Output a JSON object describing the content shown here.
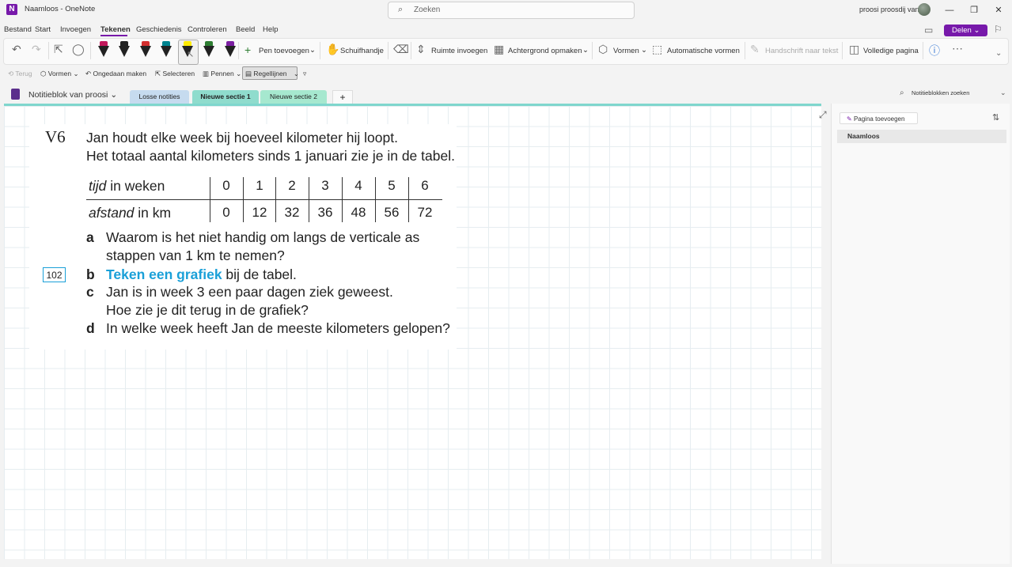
{
  "app": {
    "icon_letter": "N",
    "title": "Naamloos - OneNote",
    "search_placeholder": "Zoeken",
    "user_name": "proosi proosdij van",
    "window_controls": [
      "minimize-icon",
      "restore-icon",
      "close-icon"
    ]
  },
  "menu": {
    "items": [
      "Bestand",
      "Start",
      "Invoegen",
      "Tekenen",
      "Geschiedenis",
      "Controleren",
      "Beeld",
      "Help"
    ],
    "active": "Tekenen",
    "share_label": "Delen"
  },
  "ribbon": {
    "pen_colors": [
      "#c2185b",
      "#222222",
      "#d32f2f",
      "#00838f",
      "#ffeb00",
      "#2e7d32",
      "#7b1fa2"
    ],
    "selected_pen_color": "#ffeb00",
    "add_pen": "Pen toevoegen",
    "hand": "Schuifhandje",
    "insert_space": "Ruimte invoegen",
    "background": "Achtergrond opmaken",
    "shapes": "Vormen",
    "auto_shapes": "Automatische vormen",
    "ink_to_text": "Handschrift naar tekst",
    "full_page": "Volledige pagina"
  },
  "quick_access": {
    "back": "Terug",
    "shapes": "Vormen",
    "undo": "Ongedaan maken",
    "select": "Selecteren",
    "pens": "Pennen",
    "rule_lines": "Regellijnen"
  },
  "notebook": {
    "name": "Notitieblok van proosi",
    "tabs": [
      {
        "label": "Losse notities",
        "color": "#c6dbef"
      },
      {
        "label": "Nieuwe sectie 1",
        "color": "#8fdccd"
      },
      {
        "label": "Nieuwe sectie 2",
        "color": "#a6e8cf"
      }
    ],
    "add_tab": "+",
    "search_placeholder": "Notitieblokken zoeken"
  },
  "exercise": {
    "number": "V6",
    "intro_line1": "Jan houdt elke week bij hoeveel kilometer hij loopt.",
    "intro_line2": "Het totaal aantal kilometers sinds 1 januari zie je in de tabel.",
    "table": {
      "row1_label_italic": "tijd",
      "row1_label_rest": " in weken",
      "row1_values": [
        "0",
        "1",
        "2",
        "3",
        "4",
        "5",
        "6"
      ],
      "row2_label_italic": "afstand",
      "row2_label_rest": " in km",
      "row2_values": [
        "0",
        "12",
        "32",
        "36",
        "48",
        "56",
        "72"
      ]
    },
    "questions": {
      "a_letter": "a",
      "a_line1": "Waarom is het niet handig om langs de verticale as",
      "a_line2": "stappen van 1 km te nemen?",
      "box_number": "102",
      "b_letter": "b",
      "b_highlight": "Teken een grafiek",
      "b_rest": " bij de tabel.",
      "c_letter": "c",
      "c_line1": "Jan is in week 3 een paar dagen ziek geweest.",
      "c_line2": "Hoe zie je dit terug in de grafiek?",
      "d_letter": "d",
      "d_line1": "In welke week heeft Jan de meeste kilometers gelopen?"
    }
  },
  "pages_panel": {
    "add_page": "Pagina toevoegen",
    "pages": [
      "Naamloos"
    ]
  }
}
